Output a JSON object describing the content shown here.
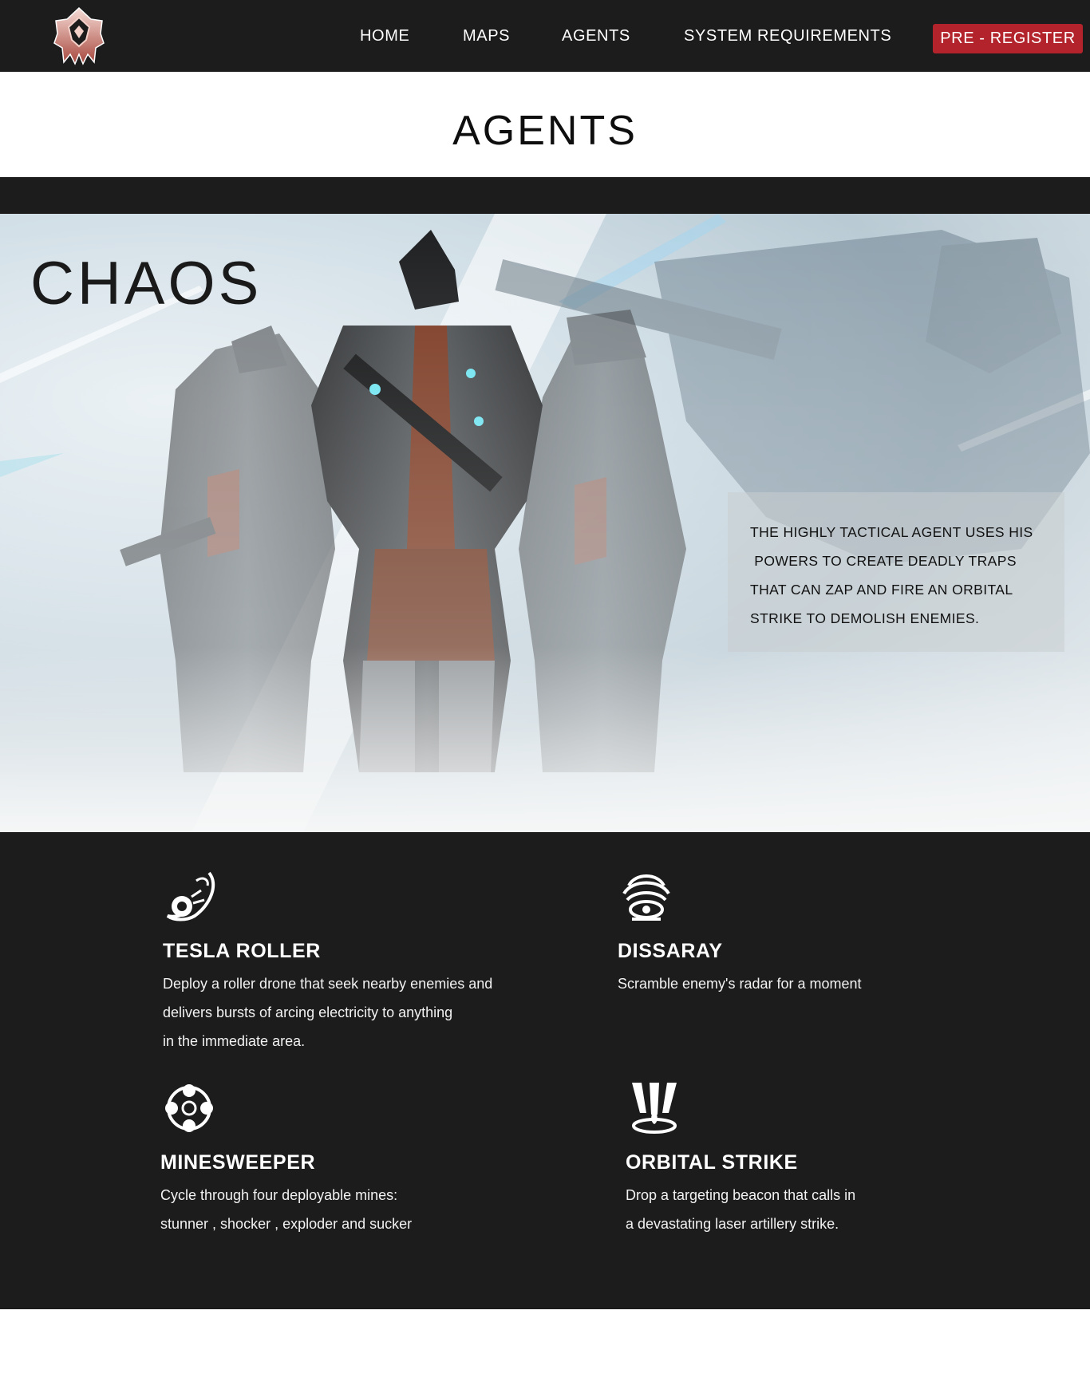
{
  "nav": {
    "logo_icon": "lotus-emblem-icon",
    "links": [
      "HOME",
      "MAPS",
      "AGENTS",
      "SYSTEM REQUIREMENTS"
    ],
    "cta_label": "PRE - REGISTER",
    "cta_color": "#b3232b",
    "bg_color": "#1c1c1d"
  },
  "page": {
    "title": "AGENTS"
  },
  "hero": {
    "agent_name": "CHAOS",
    "description_lines": [
      "THE HIGHLY TACTICAL AGENT USES HIS",
      " POWERS TO CREATE DEADLY TRAPS",
      "THAT CAN ZAP AND FIRE AN ORBITAL",
      "STRIKE TO DEMOLISH ENEMIES."
    ]
  },
  "abilities": [
    {
      "icon": "tesla-roller-icon",
      "name": "TESLA ROLLER",
      "lines": [
        "Deploy a roller drone that seek nearby enemies and",
        "delivers bursts of arcing electricity to anything",
        "in the immediate area."
      ]
    },
    {
      "icon": "dissaray-icon",
      "name": "DISSARAY",
      "lines": [
        "Scramble enemy's radar for a moment"
      ]
    },
    {
      "icon": "minesweeper-icon",
      "name": "MINESWEEPER",
      "lines": [
        "Cycle through four deployable mines:",
        "stunner , shocker , exploder and sucker"
      ]
    },
    {
      "icon": "orbital-strike-icon",
      "name": "ORBITAL STRIKE",
      "lines": [
        "Drop a targeting beacon that calls in",
        "a devastating laser artillery strike."
      ]
    }
  ]
}
